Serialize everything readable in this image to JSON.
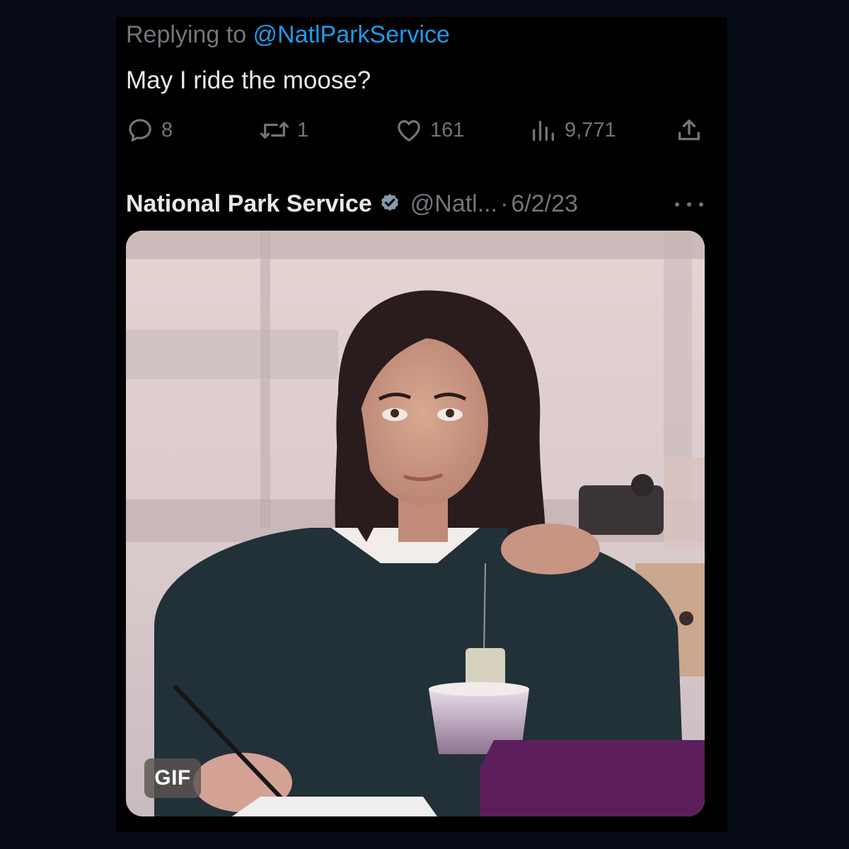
{
  "reply": {
    "prefix": "Replying to ",
    "handle": "@NatlParkService",
    "text": "May I ride the moose?"
  },
  "actions": {
    "replies": "8",
    "retweets": "1",
    "likes": "161",
    "views": "9,771"
  },
  "quoted_post": {
    "author_name": "National Park Service",
    "author_handle": "@Natl...",
    "separator": "·",
    "date": "6/2/23",
    "media_badge": "GIF"
  },
  "colors": {
    "background": "#000000",
    "outer_background": "#070b16",
    "primary_text": "#e7e9ea",
    "secondary_text": "#71767b",
    "accent_link": "#1d9bf0"
  },
  "icons": [
    "reply-icon",
    "retweet-icon",
    "like-icon",
    "views-icon",
    "share-icon",
    "verified-badge-icon",
    "more-options-icon"
  ]
}
